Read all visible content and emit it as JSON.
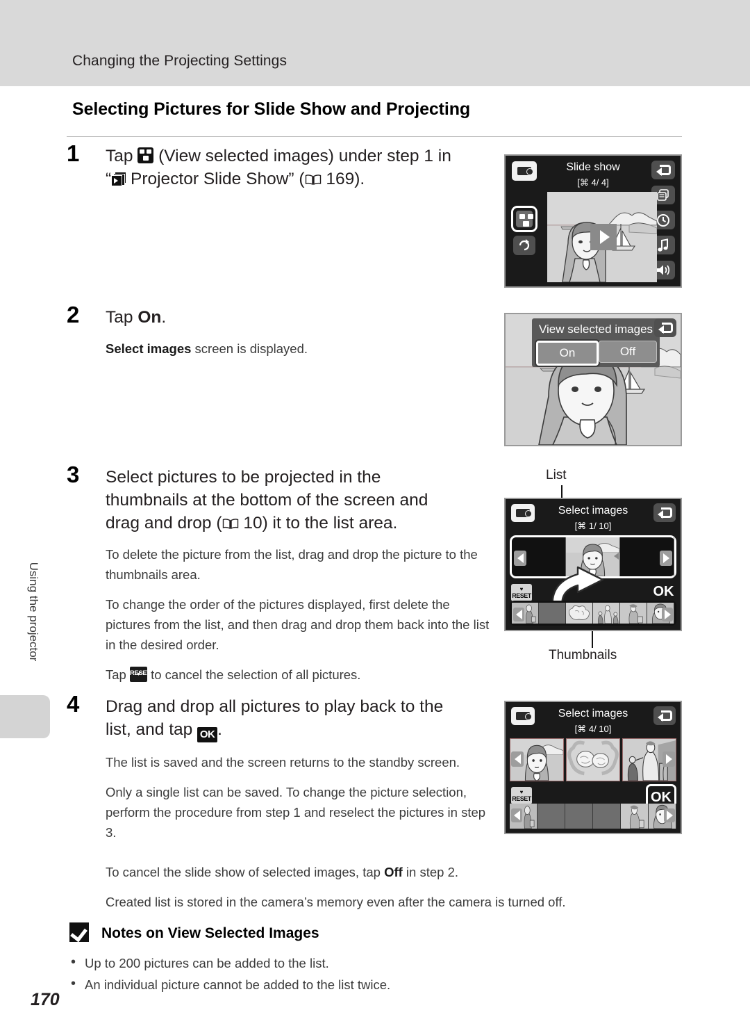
{
  "header": {
    "running_head": "Changing the Projecting Settings"
  },
  "section": {
    "title": "Selecting Pictures for Slide Show and Projecting"
  },
  "side_tab": {
    "label": "Using the projector"
  },
  "page": {
    "number": "170"
  },
  "steps": [
    {
      "number": "1",
      "head_parts": [
        "Tap ",
        "ICON_VIEWSEL",
        " (View selected images) under step 1 in",
        "“",
        "ICON_PROJ",
        " Projector Slide Show” (",
        "ICON_BOOK",
        " 169)."
      ],
      "head_line1_a": "Tap ",
      "head_line1_b": " (View selected images) under step 1 in",
      "head_line2_a": "“",
      "head_line2_b": " Projector Slide Show” (",
      "head_line2_c": " 169).",
      "sub": []
    },
    {
      "number": "2",
      "head_a": "Tap ",
      "head_bold": "On",
      "head_b": ".",
      "sub_bold": "Select images",
      "sub_rest": " screen is displayed."
    },
    {
      "number": "3",
      "head_line1": "Select pictures to be projected in the",
      "head_line2": "thumbnails at the bottom of the screen and",
      "head_line3_a": "drag and drop (",
      "head_line3_b": " 10) it to the list area.",
      "sub": [
        "To delete the picture from the list, drag and drop the picture to the thumbnails area.",
        "To change the order of the pictures displayed, first delete the pictures from the list, and then drag and drop them back into the list in the desired order."
      ],
      "sub_last_a": "Tap ",
      "sub_last_b": " to cancel the selection of all pictures."
    },
    {
      "number": "4",
      "head_line1": "Drag and drop all pictures to play back to the",
      "head_line2_a": "list, and tap ",
      "head_line2_b": ".",
      "sub": [
        "The list is saved and the screen returns to the standby screen.",
        "Only a single list can be saved. To change the picture selection, perform the procedure from step 1 and reselect the pictures in step 3."
      ],
      "sub_off_a": "To cancel the slide show of selected images, tap ",
      "sub_off_bold": "Off",
      "sub_off_b": " in step 2.",
      "sub_created": "Created list is stored in the camera’s memory even after the camera is turned off."
    }
  ],
  "screens": {
    "slide_show": {
      "title": "Slide show",
      "count": "[⌘   4/      4]",
      "icons": {
        "projector": "projector-icon",
        "back": "return-icon",
        "view_selected": "view-selected-images-icon",
        "repeat": "repeat-icon",
        "frame_interval": "frame-interval-icon",
        "clock": "clock-icon",
        "music": "music-note-icon",
        "volume": "volume-icon",
        "play": "play-icon"
      }
    },
    "view_selected_dialog": {
      "title": "View selected images",
      "option_on": "On",
      "option_off": "Off",
      "selected": "On"
    },
    "select_images_step3": {
      "title": "Select images",
      "count": "[⌘   1/    10]",
      "label_list": "List",
      "label_thumbnails": "Thumbnails",
      "reset_label": "RESET",
      "ok_label": "OK"
    },
    "select_images_step4": {
      "title": "Select images",
      "count": "[⌘   4/    10]",
      "reset_label": "RESET",
      "ok_label": "OK"
    }
  },
  "notes": {
    "title": "Notes on View Selected Images",
    "items": [
      "Up to 200 pictures can be added to the list.",
      "An individual picture cannot be added to the list twice."
    ]
  }
}
